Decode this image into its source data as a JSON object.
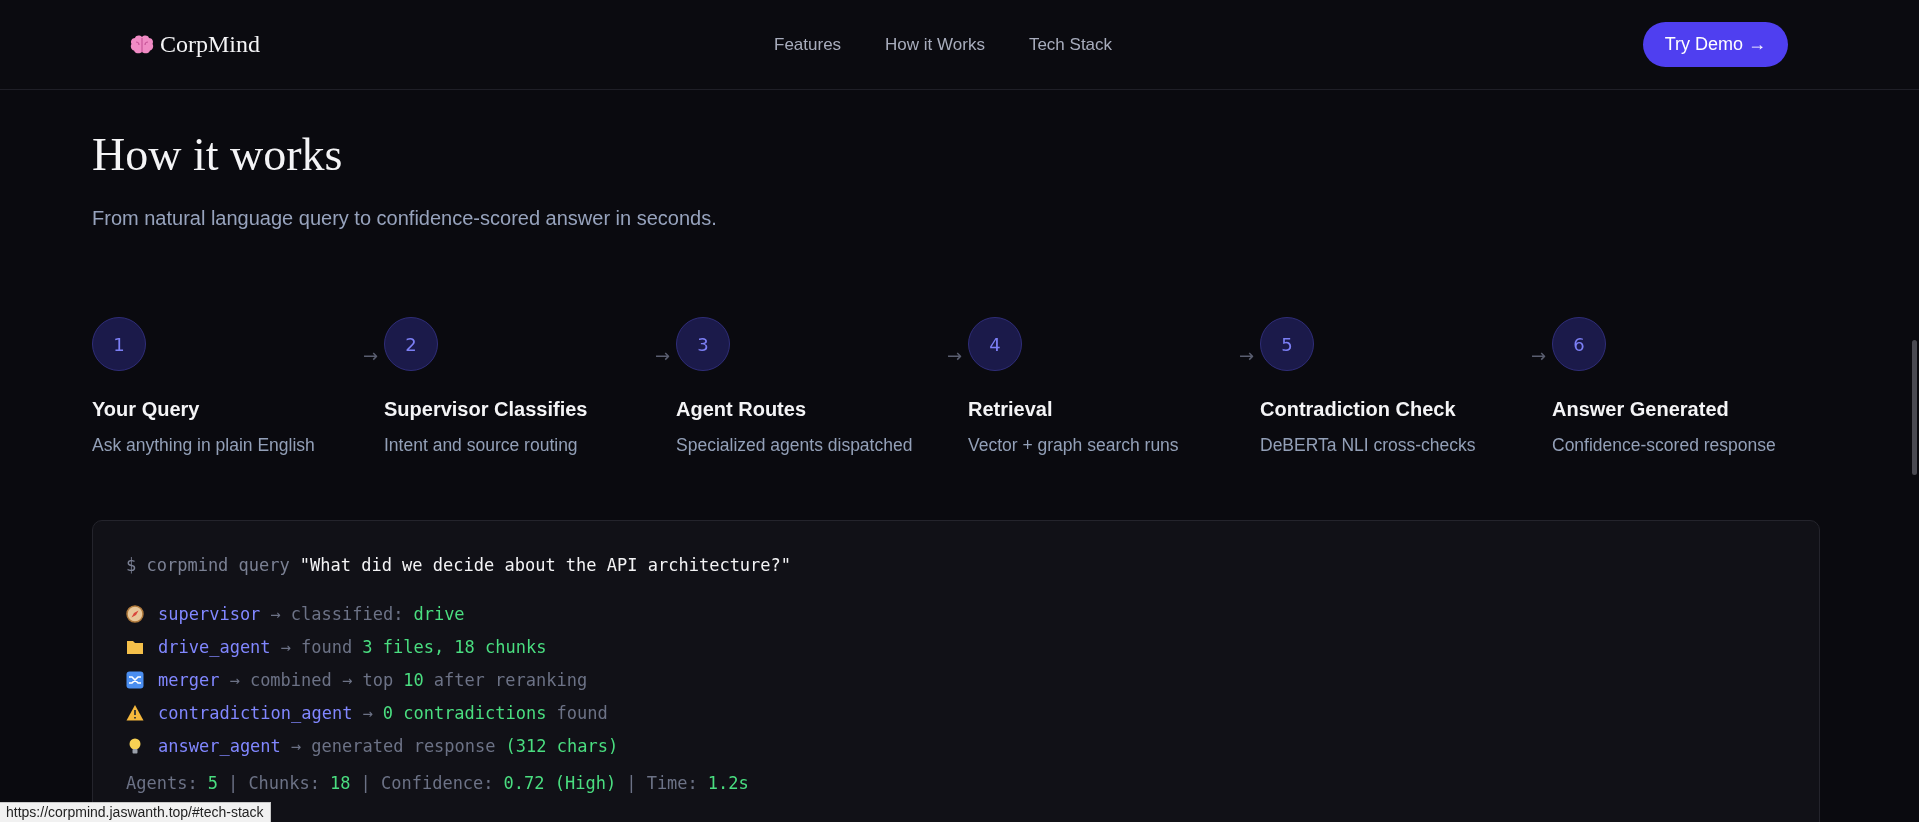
{
  "header": {
    "brand": "CorpMind",
    "nav": [
      "Features",
      "How it Works",
      "Tech Stack"
    ],
    "cta": "Try Demo →"
  },
  "section": {
    "title": "How it works",
    "subtitle": "From natural language query to confidence-scored answer in seconds."
  },
  "steps": [
    {
      "number": "1",
      "title": "Your Query",
      "description": "Ask anything in plain English"
    },
    {
      "number": "2",
      "title": "Supervisor Classifies",
      "description": "Intent and source routing"
    },
    {
      "number": "3",
      "title": "Agent Routes",
      "description": "Specialized agents dispatched"
    },
    {
      "number": "4",
      "title": "Retrieval",
      "description": "Vector + graph search runs"
    },
    {
      "number": "5",
      "title": "Contradiction Check",
      "description": "DeBERTa NLI cross-checks"
    },
    {
      "number": "6",
      "title": "Answer Generated",
      "description": "Confidence-scored response"
    }
  ],
  "step_arrow": "→",
  "terminal": {
    "prompt": "$ corpmind query",
    "query": "\"What did we decide about the API architecture?\"",
    "lines": [
      {
        "kind": "compass",
        "segments": [
          {
            "kind": "agent",
            "text": "supervisor"
          },
          {
            "kind": "muted",
            "text": "→ classified:"
          },
          {
            "kind": "value",
            "text": "drive"
          }
        ]
      },
      {
        "kind": "folder",
        "segments": [
          {
            "kind": "agent",
            "text": "drive_agent"
          },
          {
            "kind": "muted",
            "text": "→ found"
          },
          {
            "kind": "value",
            "text": "3 files, 18 chunks"
          }
        ]
      },
      {
        "kind": "shuffle",
        "segments": [
          {
            "kind": "agent",
            "text": "merger"
          },
          {
            "kind": "muted",
            "text": "→ combined → top"
          },
          {
            "kind": "value",
            "text": "10"
          },
          {
            "kind": "muted",
            "text": "after reranking"
          }
        ]
      },
      {
        "kind": "warning",
        "segments": [
          {
            "kind": "agent",
            "text": "contradiction_agent"
          },
          {
            "kind": "muted",
            "text": "→"
          },
          {
            "kind": "value",
            "text": "0 contradictions"
          },
          {
            "kind": "muted",
            "text": "found"
          }
        ]
      },
      {
        "kind": "bulb",
        "segments": [
          {
            "kind": "agent",
            "text": "answer_agent"
          },
          {
            "kind": "muted",
            "text": "→ generated response"
          },
          {
            "kind": "value",
            "text": "(312 chars)"
          }
        ]
      }
    ],
    "summary": [
      {
        "kind": "muted",
        "text": "Agents:"
      },
      {
        "kind": "value",
        "text": "5"
      },
      {
        "kind": "muted",
        "text": "| Chunks:"
      },
      {
        "kind": "value",
        "text": "18"
      },
      {
        "kind": "muted",
        "text": "| Confidence:"
      },
      {
        "kind": "value",
        "text": "0.72 (High)"
      },
      {
        "kind": "muted",
        "text": "| Time:"
      },
      {
        "kind": "value",
        "text": "1.2s"
      }
    ]
  },
  "status_bar": {
    "url": "https://corpmind.jaswanth.top/#tech-stack"
  }
}
